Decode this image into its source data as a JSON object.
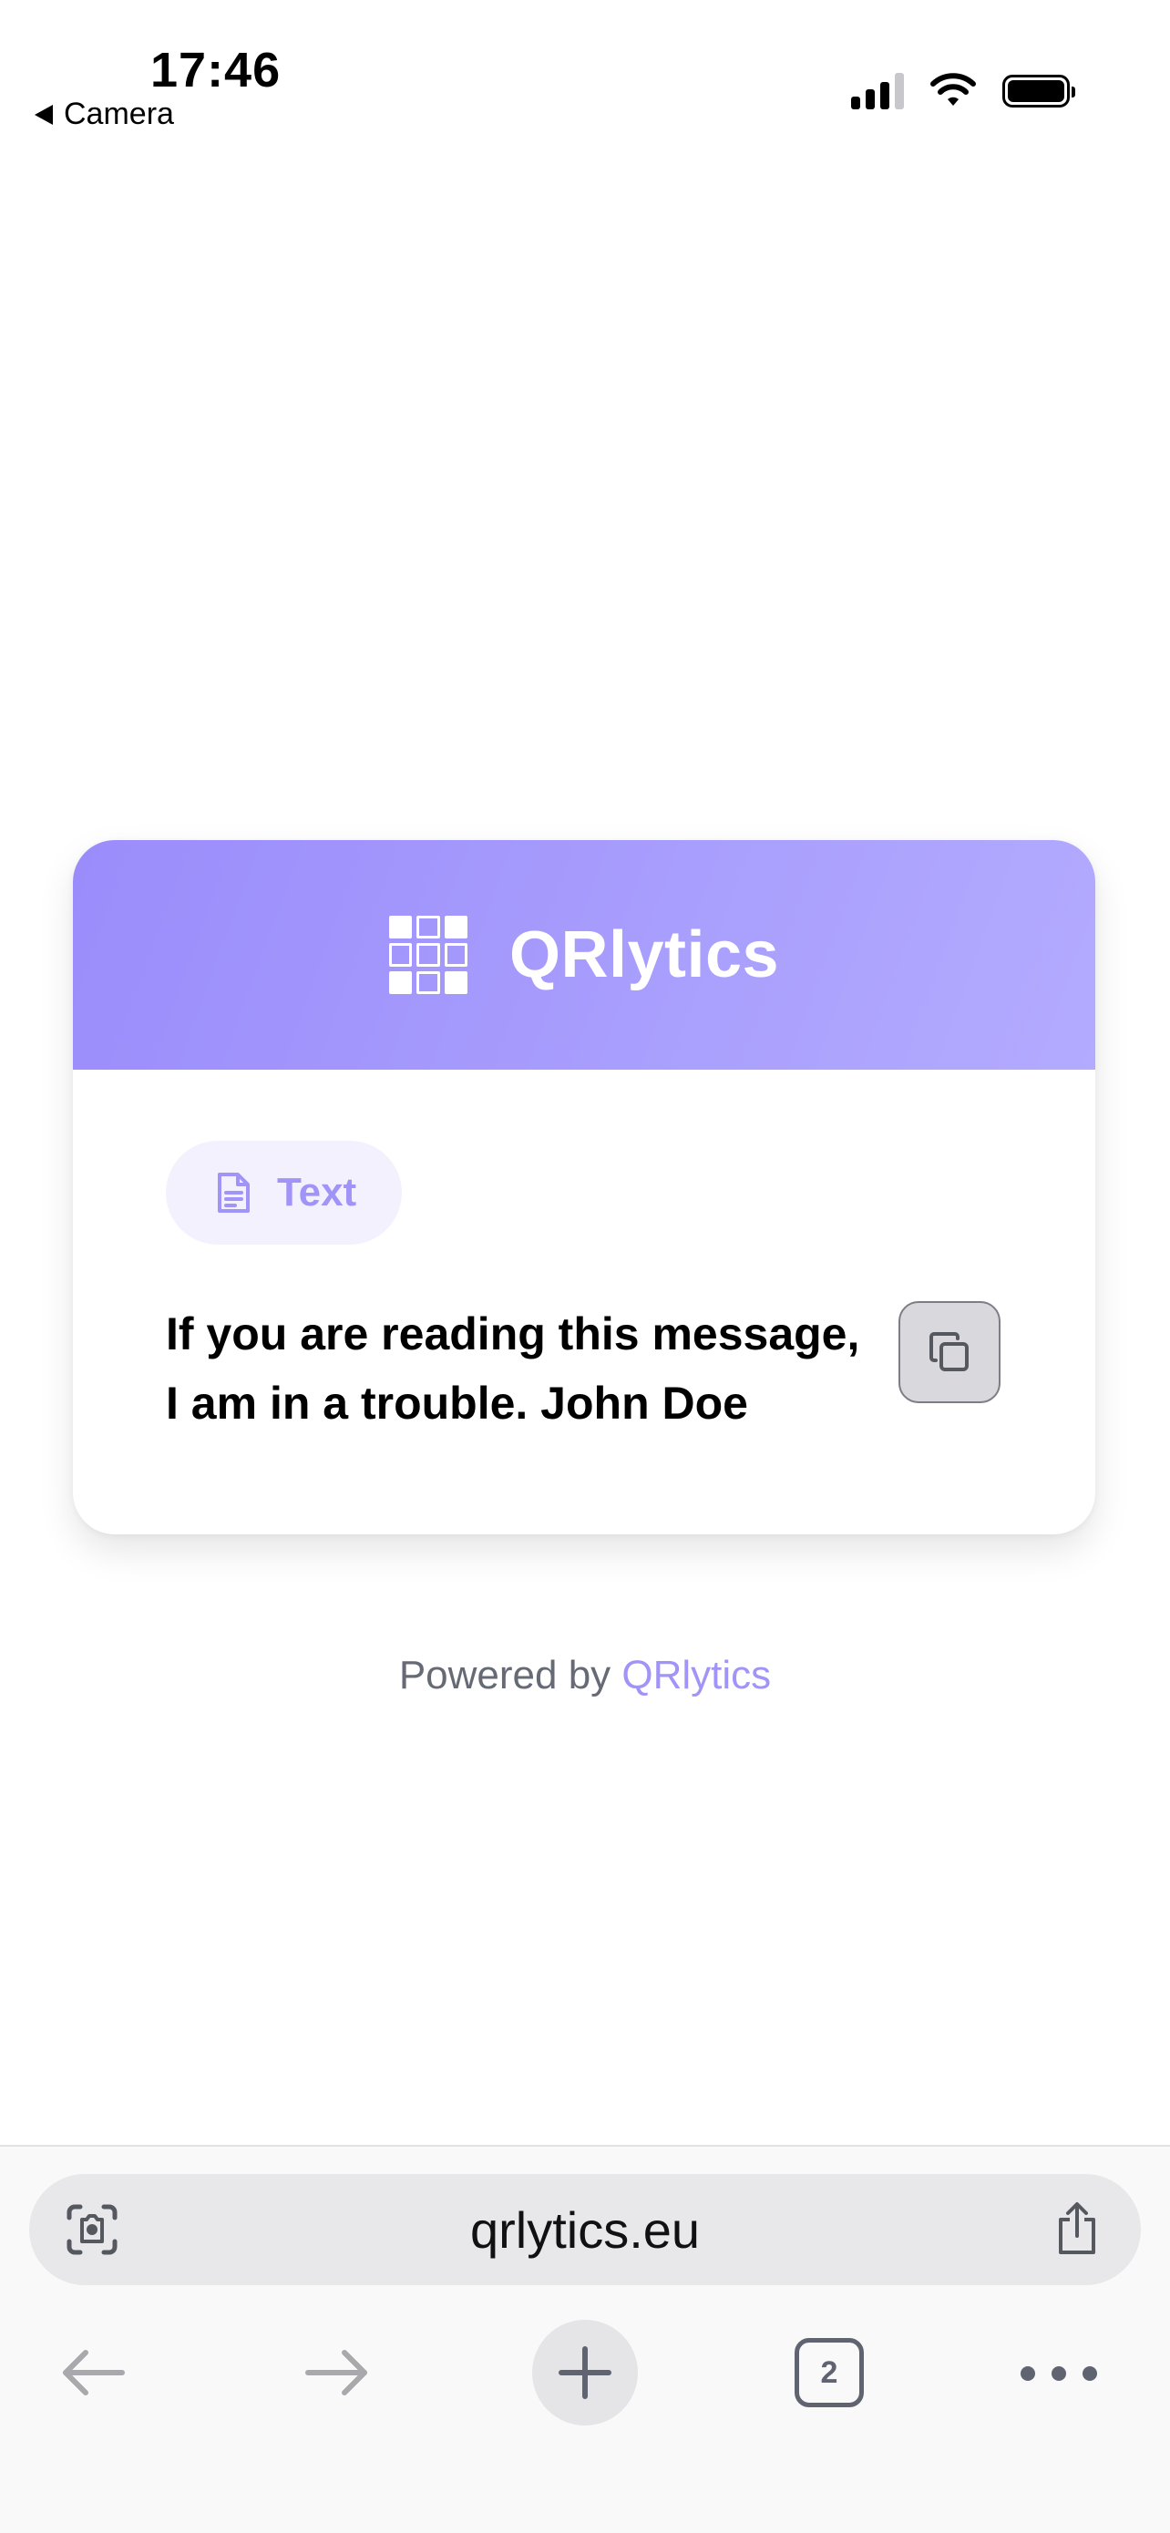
{
  "status_bar": {
    "time": "17:46",
    "back_label": "Camera",
    "icons": [
      "cellular-signal-icon",
      "wifi-icon",
      "battery-icon"
    ]
  },
  "card": {
    "brand_title": "QRlytics",
    "logo_icon": "qr-grid-icon",
    "type_badge": {
      "icon": "document-icon",
      "label": "Text"
    },
    "message": "If you are reading this message, I am in a trouble. John Doe",
    "copy_button_icon": "copy-icon"
  },
  "footer": {
    "powered_prefix": "Powered by",
    "powered_brand": "QRlytics"
  },
  "browser": {
    "url": "qrlytics.eu",
    "tabs_count": "2",
    "icons": {
      "lens": "visual-search-icon",
      "share": "share-icon",
      "back": "arrow-left-icon",
      "forward": "arrow-right-icon",
      "new_tab": "plus-icon",
      "tabs": "tabs-icon",
      "more": "more-icon"
    }
  },
  "colors": {
    "accent": "#a194f8",
    "header_start": "#9a8cfb",
    "header_end": "#b3abff",
    "badge_bg": "#f3f1fe",
    "footer_text": "#666a75",
    "browser_bar": "#f9f9f9",
    "address_bar": "#e8e8eb"
  }
}
